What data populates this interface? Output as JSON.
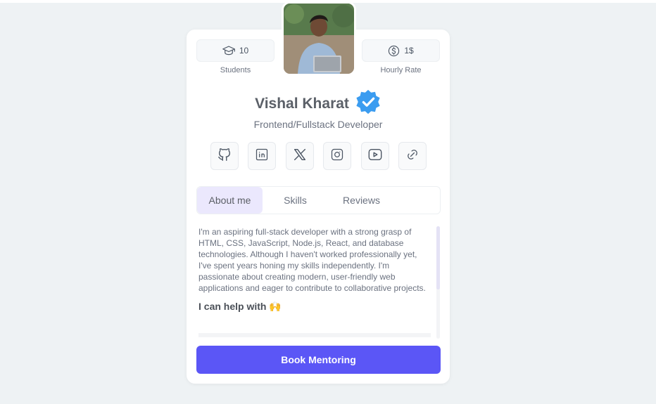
{
  "profile": {
    "name": "Vishal Kharat",
    "role": "Frontend/Fullstack Developer",
    "verified_icon": "verified-badge-icon",
    "avatar_icon": "profile-photo"
  },
  "stats": {
    "students": {
      "value": "10",
      "label": "Students",
      "icon": "graduation-cap-icon"
    },
    "rate": {
      "value": "1$",
      "label": "Hourly Rate",
      "icon": "dollar-circle-icon"
    }
  },
  "socials": [
    {
      "name": "github",
      "icon": "github-icon"
    },
    {
      "name": "linkedin",
      "icon": "linkedin-icon"
    },
    {
      "name": "x",
      "icon": "x-twitter-icon"
    },
    {
      "name": "instagram",
      "icon": "instagram-icon"
    },
    {
      "name": "youtube",
      "icon": "youtube-icon"
    },
    {
      "name": "link",
      "icon": "link-icon"
    }
  ],
  "tabs": {
    "about": "About me",
    "skills": "Skills",
    "reviews": "Reviews",
    "active": "About me"
  },
  "about": {
    "text": "I'm an aspiring full-stack developer with a strong grasp of HTML, CSS, JavaScript, Node.js, React, and database technologies. Although I haven't worked professionally yet, I've spent years honing my skills independently. I'm passionate about creating modern, user-friendly web applications and eager to contribute to collaborative projects.",
    "help_heading": "I can help with 🙌"
  },
  "cta": {
    "label": "Book Mentoring"
  },
  "colors": {
    "accent": "#5b56f6",
    "tab_active_bg": "#ebe8fd",
    "verified_blue": "#3b9cf0",
    "page_bg": "#eef2f4"
  }
}
